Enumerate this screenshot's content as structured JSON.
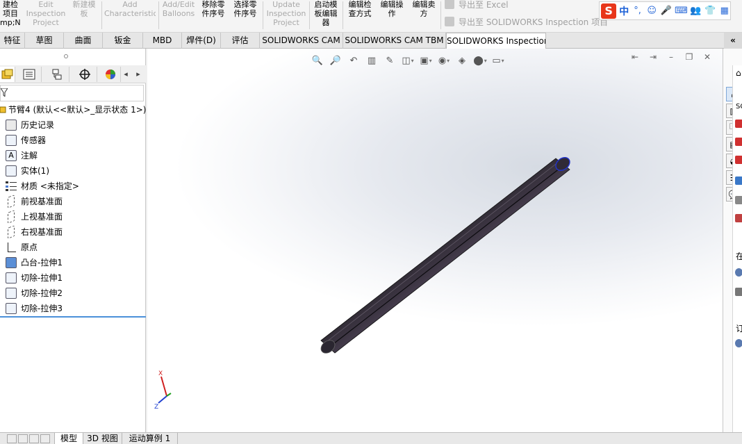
{
  "ribbon": {
    "buttons": [
      {
        "label": "建检\n项目\nmp;N)",
        "enabled": true
      },
      {
        "label": "Edit\nInspection\nProject",
        "enabled": false
      },
      {
        "label": "新建模\n板",
        "enabled": false
      },
      {
        "label": "Add\nCharacteristic",
        "enabled": false
      },
      {
        "label": "Add/Edit\nBalloons",
        "enabled": false
      },
      {
        "label": "移除零\n件序号",
        "enabled": true
      },
      {
        "label": "选择零\n件序号",
        "enabled": true
      },
      {
        "label": "Update\nInspection\nProject",
        "enabled": false
      },
      {
        "label": "启动模\n板编辑\n器",
        "enabled": true
      },
      {
        "label": "编辑检\n查方式",
        "enabled": true
      },
      {
        "label": "编辑操\n作",
        "enabled": true
      },
      {
        "label": "编辑卖\n方",
        "enabled": true
      }
    ],
    "export_excel": "导出至 Excel",
    "export_project": "导出至 SOLIDWORKS Inspection 项目"
  },
  "ime": {
    "logo": "S",
    "mode": "中",
    "punct": "°,"
  },
  "tabs": [
    {
      "label": "特征",
      "active": false
    },
    {
      "label": "草图",
      "active": false
    },
    {
      "label": "曲面",
      "active": false
    },
    {
      "label": "钣金",
      "active": false
    },
    {
      "label": "MBD",
      "active": false
    },
    {
      "label": "焊件(D)",
      "active": false
    },
    {
      "label": "评估",
      "active": false
    },
    {
      "label": "SOLIDWORKS CAM",
      "active": false
    },
    {
      "label": "SOLIDWORKS CAM TBM",
      "active": false
    },
    {
      "label": "SOLIDWORKS Inspection",
      "active": true
    }
  ],
  "tabs_more": "«",
  "tree": {
    "root": "节臂4  (默认<<默认>_显示状态 1>)",
    "items": [
      {
        "label": "历史记录",
        "icon": "history-icon"
      },
      {
        "label": "传感器",
        "icon": "sensor-icon"
      },
      {
        "label": "注解",
        "icon": "annotation-icon"
      },
      {
        "label": "实体(1)",
        "icon": "solid-bodies-icon"
      },
      {
        "label": "材质 <未指定>",
        "icon": "material-icon"
      },
      {
        "label": "前视基准面",
        "icon": "plane-icon"
      },
      {
        "label": "上视基准面",
        "icon": "plane-icon"
      },
      {
        "label": "右视基准面",
        "icon": "plane-icon"
      },
      {
        "label": "原点",
        "icon": "origin-icon"
      },
      {
        "label": "凸台-拉伸1",
        "icon": "boss-extrude-icon"
      },
      {
        "label": "切除-拉伸1",
        "icon": "cut-extrude-icon"
      },
      {
        "label": "切除-拉伸2",
        "icon": "cut-extrude-icon"
      },
      {
        "label": "切除-拉伸3",
        "icon": "cut-extrude-icon"
      }
    ]
  },
  "triad": {
    "x": "X",
    "z": "Z"
  },
  "sidecut": {
    "t1": "SC",
    "t2": "在",
    "t3": "订"
  },
  "bottom_tabs": [
    {
      "label": "模型",
      "active": true
    },
    {
      "label": "3D 视图",
      "active": false
    },
    {
      "label": "运动算例 1",
      "active": false
    }
  ],
  "colors": {
    "accent": "#4a90d9",
    "part": "#3a3340",
    "ime_logo": "#e8361a"
  }
}
